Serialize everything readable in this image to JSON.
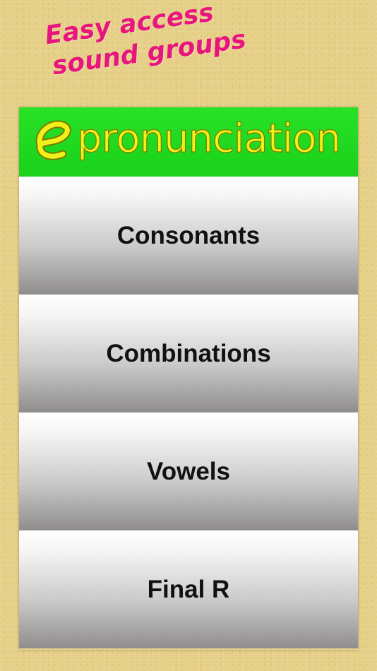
{
  "promo": {
    "line1": "Easy access",
    "line2": "sound groups"
  },
  "app": {
    "logo_letter": "e",
    "title": "pronunciation"
  },
  "menu": [
    {
      "label": "Consonants"
    },
    {
      "label": "Combinations"
    },
    {
      "label": "Vowels"
    },
    {
      "label": "Final R"
    }
  ]
}
